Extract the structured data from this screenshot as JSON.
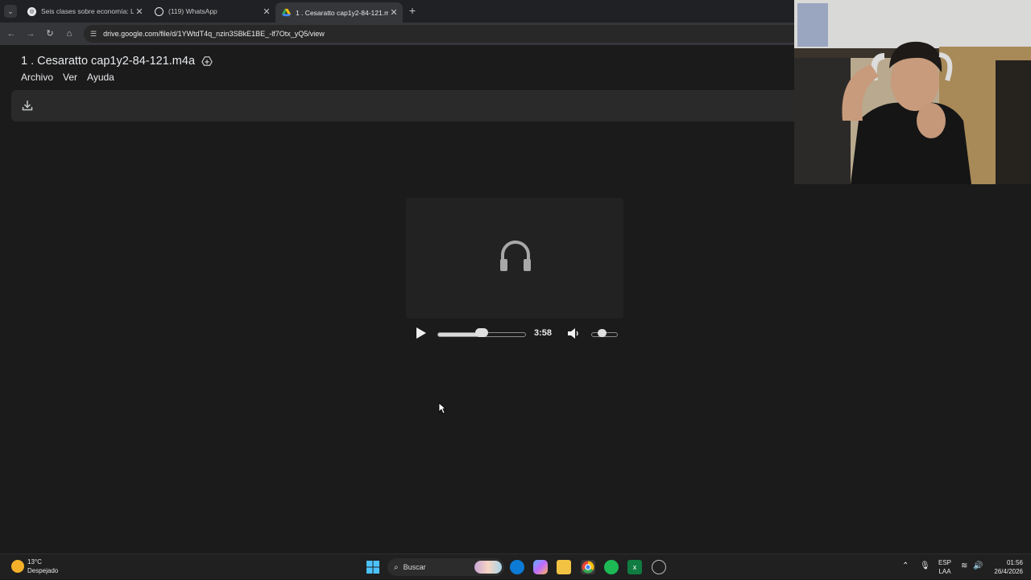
{
  "browser": {
    "tabs": [
      {
        "title": "Seis clases sobre economía: La",
        "icon": "circle-logo-icon",
        "active": false
      },
      {
        "title": "(119) WhatsApp",
        "icon": "whatsapp-icon",
        "active": false
      },
      {
        "title": "1 . Cesaratto cap1y2-84-121.m4a",
        "icon": "google-drive-icon",
        "active": true
      }
    ],
    "new_tab_label": "+",
    "url": "drive.google.com/file/d/1YWtdT4q_nzin3SBkE1BE_-lf7Otx_yQ5/view"
  },
  "drive": {
    "file_title": "1 . Cesaratto cap1y2-84-121.m4a",
    "menu": [
      "Archivo",
      "Ver",
      "Ayuda"
    ]
  },
  "player": {
    "time": "3:58",
    "progress": 0.5,
    "volume": 0.25,
    "icon": "headphones-icon"
  },
  "taskbar": {
    "weather_temp": "13°C",
    "weather_desc": "Despejado",
    "search_placeholder": "Buscar",
    "lang_1": "ESP",
    "lang_2": "LAA",
    "clock_time": "01:56",
    "clock_date": "26/4/2026"
  },
  "colors": {
    "page_bg": "#1b1b1b",
    "player_bg": "#222222",
    "tab_active": "#35363a"
  }
}
